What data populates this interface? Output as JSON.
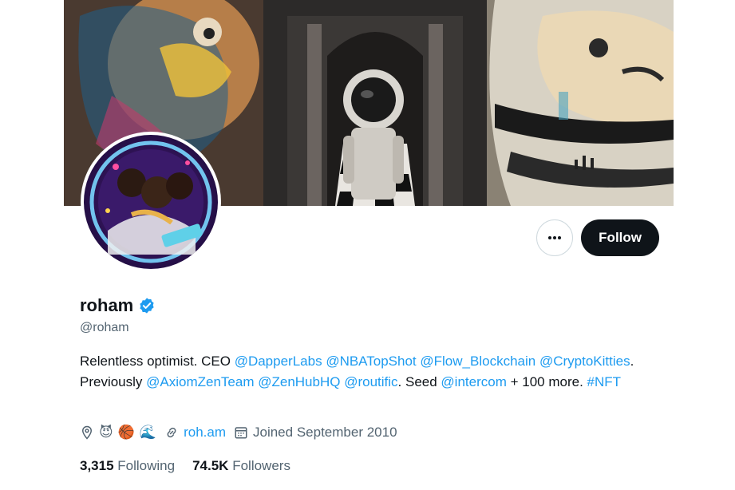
{
  "profile": {
    "display_name": "roham",
    "handle": "@roham",
    "verified": true,
    "accent_color": "#1d9bf0"
  },
  "actions": {
    "more_label": "···",
    "follow_label": "Follow"
  },
  "bio": {
    "p1": "Relentless optimist. CEO ",
    "l1": "@DapperLabs",
    "s1": " ",
    "l2": "@NBATopShot",
    "s2": " ",
    "l3": "@Flow_Blockchain",
    "s3": " ",
    "l4": "@CryptoKitties",
    "p2": ". Previously ",
    "l5": "@AxiomZenTeam",
    "s4": " ",
    "l6": "@ZenHubHQ",
    "s5": " ",
    "l7": "@routific",
    "p3": ". Seed ",
    "l8": "@intercom",
    "p4": " + 100 more. ",
    "l9": "#NFT"
  },
  "meta": {
    "location_emojis": [
      "😈",
      "🏀",
      "🌊"
    ],
    "website": "roh.am",
    "joined": "Joined September 2010"
  },
  "stats": {
    "following_count": "3,315",
    "following_label": "Following",
    "followers_count": "74.5K",
    "followers_label": "Followers"
  },
  "icons": {
    "location": "location-pin-icon",
    "link": "link-icon",
    "calendar": "calendar-icon",
    "verified": "verified-badge-icon",
    "more": "more-horizontal-icon"
  }
}
